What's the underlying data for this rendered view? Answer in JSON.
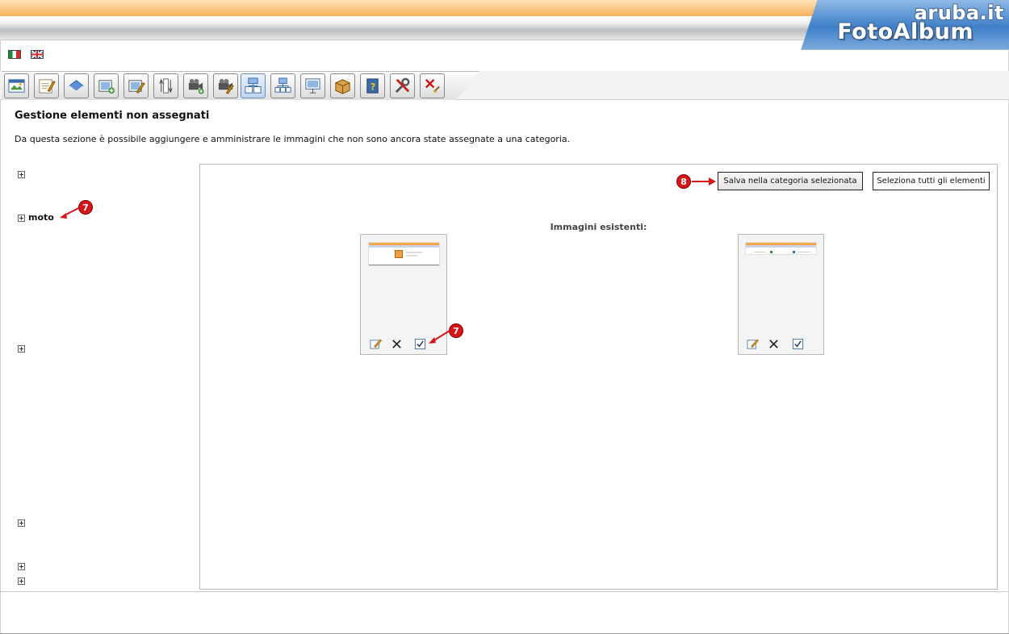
{
  "header": {
    "brand_small": "aruba.it",
    "brand_large": "FotoAlbum"
  },
  "languages": [
    {
      "code": "it",
      "name": "Italiano"
    },
    {
      "code": "en",
      "name": "English"
    }
  ],
  "toolbar": {
    "tools": [
      {
        "icon": "album-icon"
      },
      {
        "icon": "edit-album-icon"
      },
      {
        "icon": "category-icon"
      },
      {
        "icon": "add-image-icon"
      },
      {
        "icon": "edit-image-icon"
      },
      {
        "icon": "sort-icon"
      },
      {
        "icon": "add-video-icon"
      },
      {
        "icon": "edit-video-icon"
      },
      {
        "icon": "unassigned-elements-icon",
        "active": true
      },
      {
        "icon": "structure-icon"
      },
      {
        "icon": "slideshow-icon"
      },
      {
        "icon": "package-icon"
      },
      {
        "icon": "help-icon"
      },
      {
        "icon": "settings-icon"
      },
      {
        "icon": "delete-album-icon"
      }
    ]
  },
  "page": {
    "title": "Gestione elementi non assegnati",
    "description": "Da questa sezione è possibile aggiungere e amministrare le immagini che non sono ancora state assegnate a una categoria."
  },
  "tree": {
    "selected_label": "moto"
  },
  "main": {
    "save_button": "Salva nella categoria selezionata",
    "select_all_button": "Seleziona tutti gli elementi",
    "existing_title": "Immagini esistenti:",
    "images": [
      {
        "edit_icon": "edit-icon",
        "delete_icon": "delete-icon",
        "select_icon": "checkbox-icon"
      },
      {
        "edit_icon": "edit-icon",
        "delete_icon": "delete-icon",
        "select_icon": "checkbox-icon"
      }
    ]
  },
  "annotations": {
    "tree_marker": "7",
    "checkbox_marker": "7",
    "save_marker": "8"
  },
  "colors": {
    "accent_orange": "#f7b25c",
    "marker_red": "#d8141b",
    "link_blue": "#4d8bd8"
  }
}
